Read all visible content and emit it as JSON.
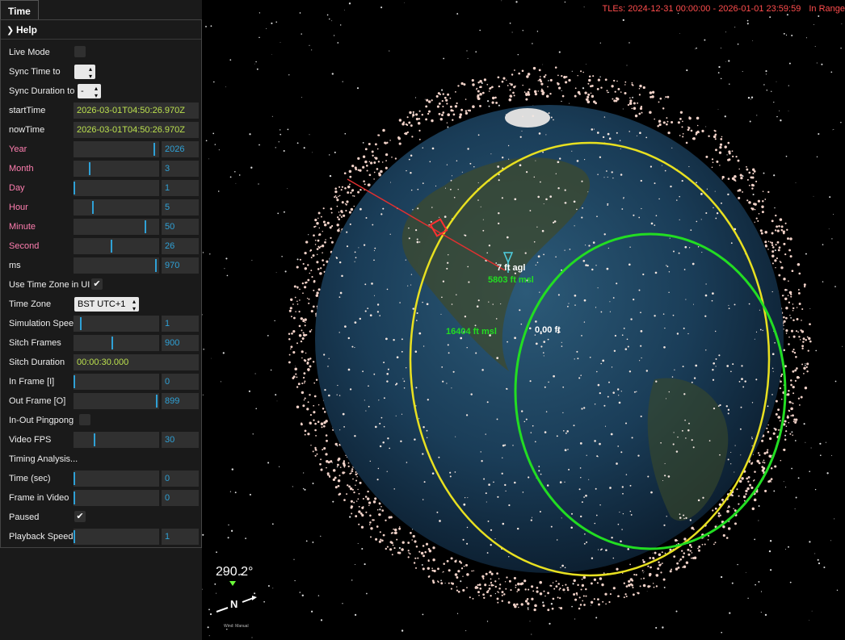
{
  "tab": {
    "label": "Time"
  },
  "help": {
    "label": "Help"
  },
  "controls": {
    "live_mode": {
      "label": "Live Mode",
      "checked": false
    },
    "sync_time": {
      "label": "Sync Time to"
    },
    "sync_duration": {
      "label": "Sync Duration to",
      "value": "-"
    },
    "start_time": {
      "label": "startTime",
      "value": "2026-03-01T04:50:26.970Z"
    },
    "now_time": {
      "label": "nowTime",
      "value": "2026-03-01T04:50:26.970Z"
    },
    "year": {
      "label": "Year",
      "value": "2026",
      "level": 0.95
    },
    "month": {
      "label": "Month",
      "value": "3",
      "level": 0.18
    },
    "day": {
      "label": "Day",
      "value": "1",
      "level": 0.0
    },
    "hour": {
      "label": "Hour",
      "value": "5",
      "level": 0.22
    },
    "minute": {
      "label": "Minute",
      "value": "50",
      "level": 0.85
    },
    "second": {
      "label": "Second",
      "value": "26",
      "level": 0.44
    },
    "ms": {
      "label": "ms",
      "value": "970",
      "level": 0.97
    },
    "use_time_zone": {
      "label": "Use Time Zone in UI",
      "checked": true
    },
    "time_zone": {
      "label": "Time Zone",
      "value": "BST UTC+1"
    },
    "simulation_speed": {
      "label": "Simulation Speed",
      "value": "1",
      "level": 0.08
    },
    "sitch_frames": {
      "label": "Sitch Frames",
      "value": "900",
      "level": 0.45
    },
    "sitch_duration": {
      "label": "Sitch Duration",
      "value": "00:00:30.000"
    },
    "in_frame": {
      "label": "In Frame [I]",
      "value": "0",
      "level": 0.0
    },
    "out_frame": {
      "label": "Out Frame [O]",
      "value": "899",
      "level": 0.98
    },
    "in_out_pingpong": {
      "label": "In-Out Pingpong",
      "checked": false
    },
    "video_fps": {
      "label": "Video FPS",
      "value": "30",
      "level": 0.24
    },
    "timing_analysis": {
      "label": "Timing Analysis..."
    },
    "time_sec": {
      "label": "Time (sec)",
      "value": "0",
      "level": 0.0
    },
    "frame_in_video": {
      "label": "Frame in Video",
      "value": "0",
      "level": 0.0
    },
    "paused": {
      "label": "Paused",
      "checked": true
    },
    "playback_speed": {
      "label": "Playback Speed",
      "value": "1",
      "level": 0.0
    }
  },
  "status": {
    "tles": "TLEs: 2024-12-31 00:00:00 - 2026-01-01 23:59:59",
    "range": "In Range"
  },
  "overlay": {
    "agl": "7 ft agl",
    "msl_target": "5803 ft msl",
    "msl_orbit": "16404 ft msl",
    "zero": "0.00 ft"
  },
  "compass": {
    "heading": "290.2°",
    "north": "N",
    "caption": "Wind: Manual"
  },
  "colors": {
    "accent": "#2fa1d6",
    "text_value": "#bbe04e",
    "pink_label": "#ff7eb0",
    "status_red": "#ff4d4d",
    "ring_yellow": "#e8e020",
    "ring_green": "#22dd22"
  }
}
